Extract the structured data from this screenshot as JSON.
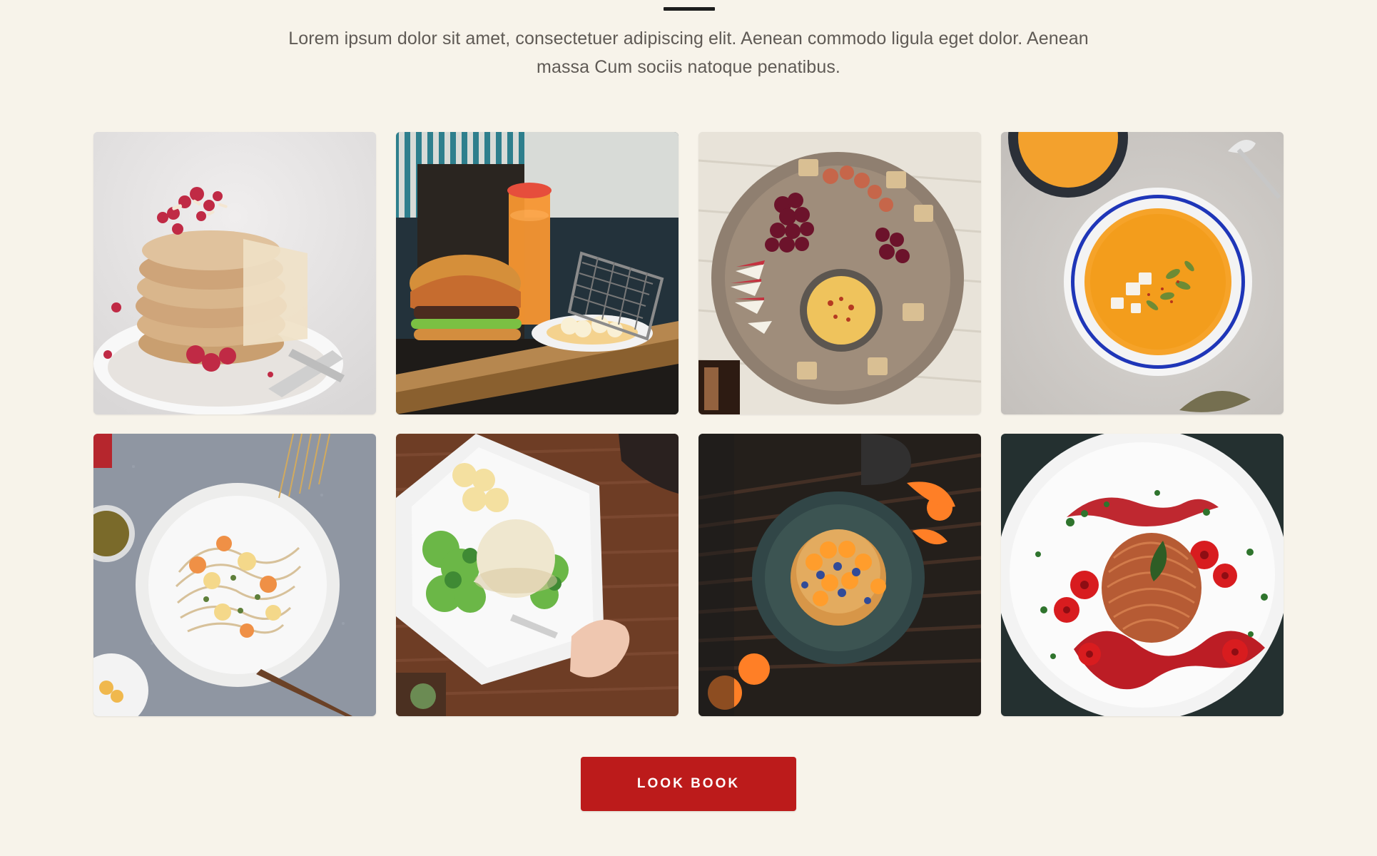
{
  "section": {
    "intro_text": "Lorem ipsum dolor sit amet, consectetuer adipiscing elit. Aenean commodo ligula eget dolor. Aenean massa Cum sociis natoque penatibus."
  },
  "gallery": {
    "items": [
      {
        "icon": "pancake-stack-photo"
      },
      {
        "icon": "burger-and-drink-photo"
      },
      {
        "icon": "charcuterie-board-photo"
      },
      {
        "icon": "pumpkin-soup-photo"
      },
      {
        "icon": "pasta-plate-photo"
      },
      {
        "icon": "burger-salad-photo"
      },
      {
        "icon": "pancake-oranges-photo"
      },
      {
        "icon": "spaghetti-tomatoes-photo"
      }
    ]
  },
  "cta": {
    "label": "LOOK BOOK",
    "background": "#bc1b1b",
    "text_color": "#ffffff"
  },
  "theme": {
    "page_background": "#f7f3ea",
    "divider_color": "#1c1c1c",
    "text_color": "#5f5a55"
  }
}
